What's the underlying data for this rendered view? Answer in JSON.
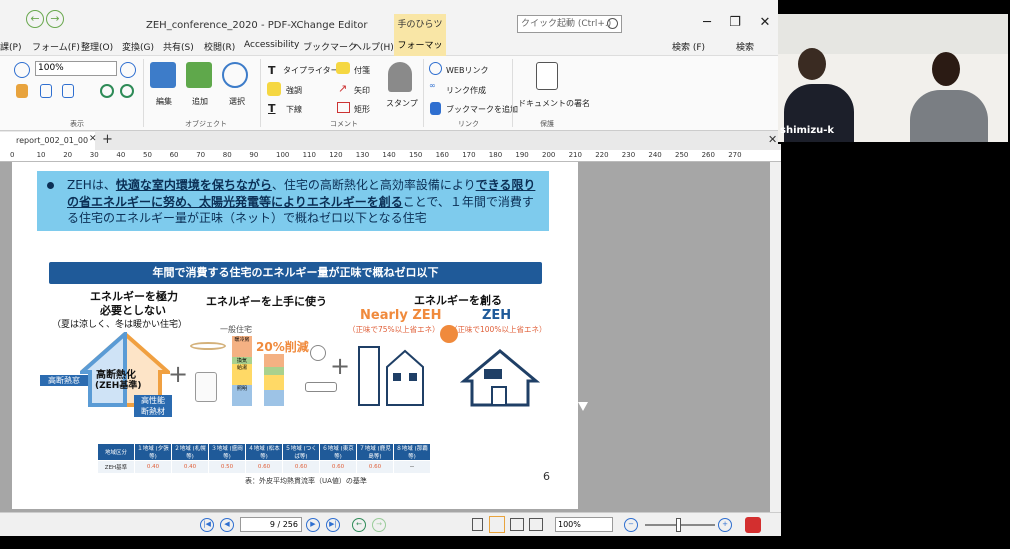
{
  "window": {
    "title": "ZEH_conference_2020 - PDF-XChange Editor",
    "context_tab": "手のひらツール",
    "search_placeholder": "クイック起動 (Ctrl+.)",
    "min": "─",
    "max": "❐",
    "close": "✕"
  },
  "menus": [
    "課(P)",
    "フォーム(F)",
    "整理(O)",
    "変換(G)",
    "共有(S)",
    "校閲(R)",
    "Accessibility",
    "ブックマーク",
    "ヘルプ(H)"
  ],
  "menu_format": "フォーマット",
  "menu_right": {
    "find": "検索 (F)",
    "search": "検索"
  },
  "ribbon": {
    "zoom_value": "100%",
    "view_group": "表示",
    "object_group": "オブジェクト",
    "comment_group": "コメント",
    "link_group": "リンク",
    "protect_group": "保護",
    "edit": "編集",
    "add": "追加",
    "select": "選択",
    "typewriter": "タイプライター",
    "sticky": "付箋",
    "highlight": "強調",
    "arrow": "矢印",
    "underline": "下線",
    "rect": "矩形",
    "stamp": "スタンプ",
    "web_link": "WEBリンク",
    "create_link": "リンク作成",
    "add_bookmark": "ブックマークを追加",
    "sign": "ドキュメントの署名"
  },
  "tab": {
    "name": "report_002_01_00",
    "close": "✕",
    "add": "+"
  },
  "ruler_ticks": [
    "0",
    "10",
    "20",
    "30",
    "40",
    "50",
    "60",
    "70",
    "80",
    "90",
    "100",
    "110",
    "120",
    "130",
    "140",
    "150",
    "160",
    "170",
    "180",
    "190",
    "200",
    "210",
    "220",
    "230",
    "240",
    "250",
    "260",
    "270"
  ],
  "slide": {
    "bullet_pre": "ZEHは、",
    "bullet_u1": "快適な室内環境を保ちながら",
    "bullet_mid": "、住宅の高断熱化と高効率設備により",
    "bullet_u2": "できる限りの省エネルギーに努め、太陽光発電等によりエネルギーを創る",
    "bullet_post": "ことで、１年間で消費する住宅のエネルギー量が正味（ネット）で概ねゼロ以下となる住宅",
    "banner": "年間で消費する住宅のエネルギー量が正味で概ねゼロ以下",
    "col1_title1": "エネルギーを極力",
    "col1_title2": "必要としない",
    "col1_sub": "（夏は涼しく、冬は暖かい住宅）",
    "col2_title": "エネルギーを上手に使う",
    "col3_title": "エネルギーを創る",
    "general_house": "一般住宅",
    "reduction": "20%削減",
    "nearly_zeh": "Nearly ZEH",
    "zeh": "ZEH",
    "nearly_note": "（正味で75%以上省エネ）",
    "zeh_note": "（正味で100%以上省エネ）",
    "window_label": "高断熱窓",
    "house_label1": "高断熱化",
    "house_label2": "(ZEH基準)",
    "insulation_label1": "高性能",
    "insulation_label2": "断熱材",
    "bar_labels": [
      "暖冷房",
      "換気",
      "給湯",
      "照明"
    ],
    "table_header": [
      "地域区分",
      "１地域\n(夕張等)",
      "２地域\n(札幌等)",
      "３地域\n(盛岡等)",
      "４地域\n(松本等)",
      "５地域\n(つくば等)",
      "６地域\n(東京等)",
      "７地域\n(鹿児島等)",
      "８地域\n(那覇等)"
    ],
    "table_values": [
      "ZEH基準",
      "0.40",
      "0.40",
      "0.50",
      "0.60",
      "0.60",
      "0.60",
      "0.60",
      "－"
    ],
    "caption": "表：外皮平均熱貫流率（UA値）の基準",
    "page_number": "6"
  },
  "status": {
    "page": "9",
    "total": "256",
    "zoom": "100%"
  },
  "video": {
    "name": "shimizu-k"
  }
}
